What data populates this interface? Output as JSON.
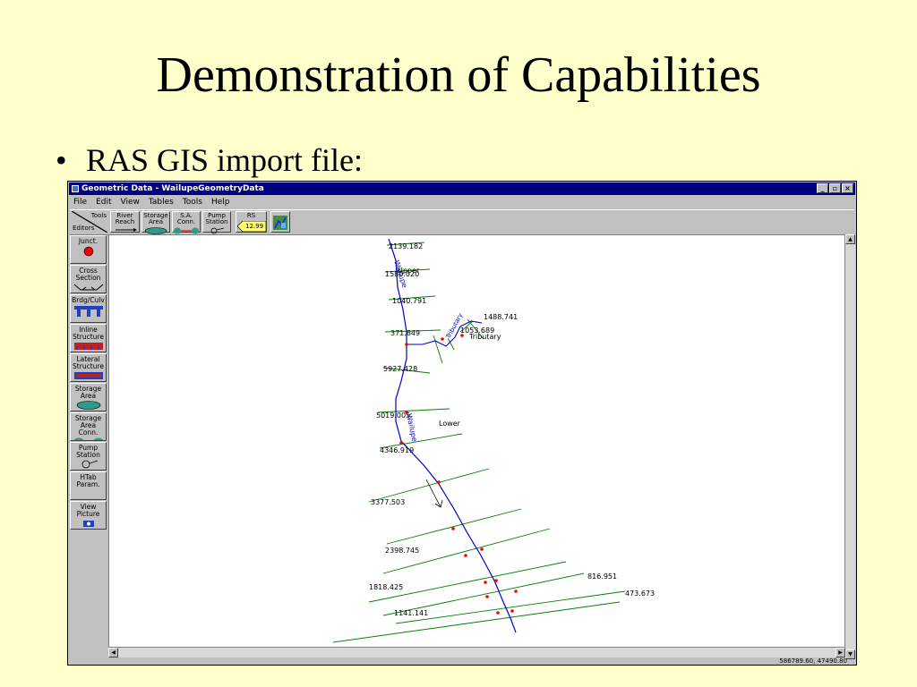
{
  "slide": {
    "title": "Demonstration of Capabilities",
    "bullet": "•",
    "bullet_text": "RAS GIS import file:"
  },
  "window": {
    "title": "Geometric Data - WailupeGeometryData",
    "controls": [
      "_",
      "▫",
      "×"
    ],
    "titlebar_color": "#000080"
  },
  "menu": [
    "File",
    "Edit",
    "View",
    "Tables",
    "Tools",
    "Help"
  ],
  "toolbar": {
    "tools_label": "Tools",
    "editors_label": "Editors",
    "buttons": [
      {
        "line1": "River",
        "line2": "Reach",
        "icon": "river-reach-icon"
      },
      {
        "line1": "Storage",
        "line2": "Area",
        "icon": "storage-area-icon"
      },
      {
        "line1": "S.A.",
        "line2": "Conn.",
        "icon": "sa-connection-icon"
      },
      {
        "line1": "Pump",
        "line2": "Station",
        "icon": "pump-station-icon"
      }
    ],
    "rs_label": "RS",
    "rs_value": "12.99",
    "map_icon": "georeference-map-icon"
  },
  "editors": [
    {
      "line1": "Junct.",
      "line2": "",
      "icon": "junction-icon"
    },
    {
      "line1": "Cross",
      "line2": "Section",
      "icon": "cross-section-icon"
    },
    {
      "line1": "Brdg/Culv",
      "line2": "",
      "icon": "bridge-culvert-icon"
    },
    {
      "line1": "Inline",
      "line2": "Structure",
      "icon": "inline-structure-icon"
    },
    {
      "line1": "Lateral",
      "line2": "Structure",
      "icon": "lateral-structure-icon"
    },
    {
      "line1": "Storage",
      "line2": "Area",
      "icon": "storage-area-icon"
    },
    {
      "line1": "Storage",
      "line2": "Area Conn.",
      "icon": "storage-area-connection-icon"
    },
    {
      "line1": "Pump",
      "line2": "Station",
      "icon": "pump-station-icon"
    },
    {
      "line1": "HTab",
      "line2": "Param.",
      "icon": ""
    },
    {
      "line1": "View",
      "line2": "Picture",
      "icon": "camera-icon"
    }
  ],
  "map": {
    "reach_color": "#0000CC",
    "cross_section_color": "#008000",
    "marker_color": "#FF0000",
    "river_labels": [
      "Wailupe",
      "Wailupe"
    ],
    "reach_labels": [
      "Upper",
      "Tributary",
      "Lower"
    ],
    "tributary_label": "Tributary",
    "station_labels": [
      "2139.182",
      "1580.020",
      "1040.791",
      "1488.741",
      "1053.689",
      "371.849",
      "5927.428",
      "5019.005",
      "4346.919",
      "3377.503",
      "2398.745",
      "1818.425",
      "816.951",
      "473.673",
      "1141.141"
    ]
  },
  "status": {
    "coordinates": "586789.60, 47490.80"
  }
}
